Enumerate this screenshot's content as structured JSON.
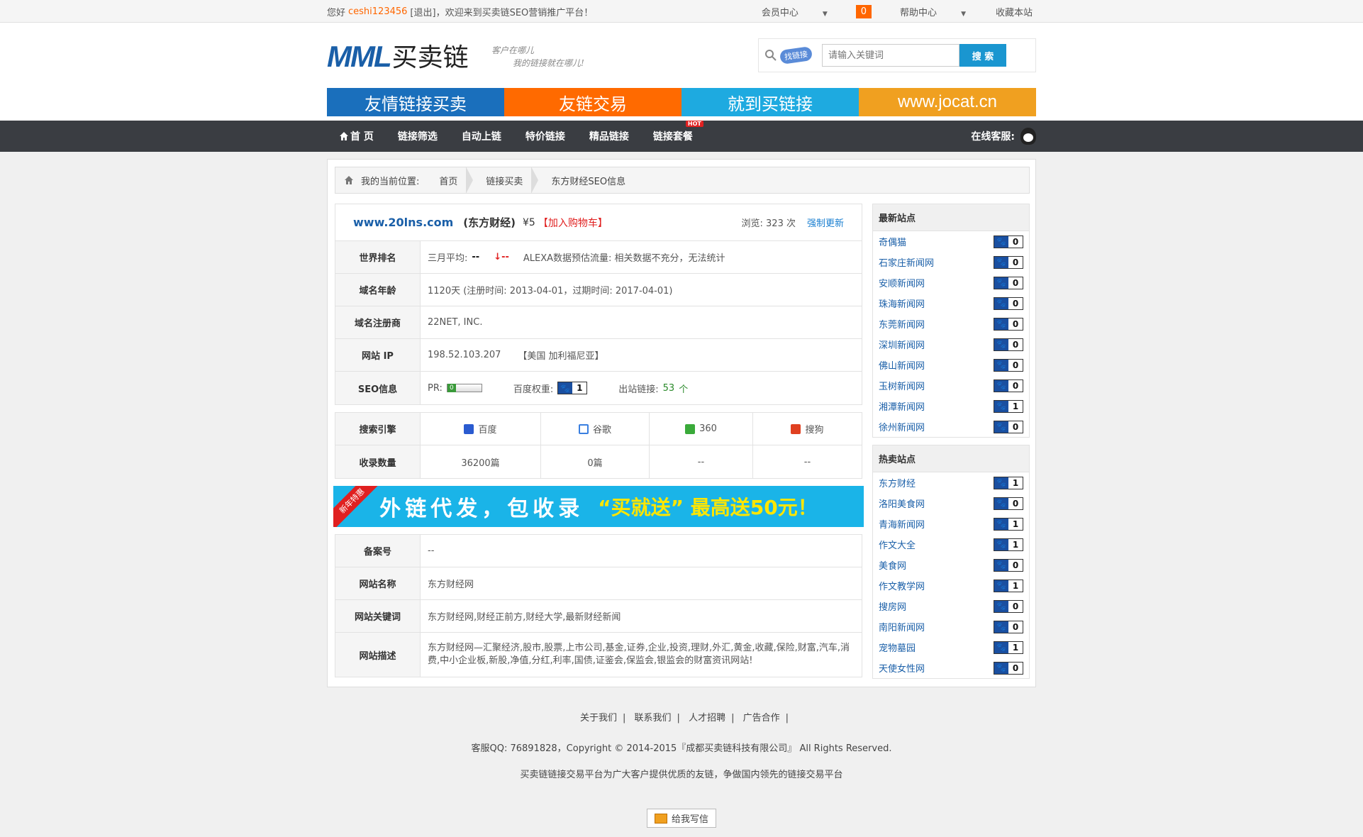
{
  "topbar": {
    "greeting": "您好",
    "username": "ceshi123456",
    "logout": "[退出]",
    "welcome": "，欢迎来到买卖链SEO营销推广平台！",
    "member": "会员中心",
    "cart_count": "0",
    "help": "帮助中心",
    "favorite": "收藏本站"
  },
  "header": {
    "logo_latin": "MML",
    "logo_cn": "买卖链",
    "slogan1": "客户在哪儿",
    "slogan2": "我的链接就在哪儿!",
    "search_badge": "找链接",
    "search_placeholder": "请输入关键词",
    "search_button": "搜 索",
    "banner": [
      "友情链接买卖",
      "友链交易",
      "就到买链接",
      "www.jocat.cn"
    ]
  },
  "nav": {
    "items": [
      "首 页",
      "链接筛选",
      "自动上链",
      "特价链接",
      "精品链接",
      "链接套餐"
    ],
    "hot": "HOT",
    "service": "在线客服:"
  },
  "breadcrumb": {
    "label": "我的当前位置:",
    "items": [
      "首页",
      "链接买卖",
      "东方财经SEO信息"
    ]
  },
  "site": {
    "url": "www.20lns.com",
    "name": "(东方财经)",
    "price": "¥5",
    "add_cart": "【加入购物车】",
    "views": "浏览: 323 次",
    "refresh": "强制更新"
  },
  "info": {
    "rank_label": "世界排名",
    "rank_avg": "三月平均:",
    "rank_val": "--",
    "rank_trend": "↓--",
    "rank_note": "ALEXA数据预估流量: 相关数据不充分，无法统计",
    "age_label": "域名年龄",
    "age_val": "1120天 (注册时间: 2013-04-01，过期时间: 2017-04-01)",
    "registrar_label": "域名注册商",
    "registrar_val": "22NET, INC.",
    "ip_label": "网站 IP",
    "ip_val": "198.52.103.207",
    "ip_loc": "【美国 加利福尼亚】",
    "seo_label": "SEO信息",
    "pr_label": "PR:",
    "weight_label": "百度权重:",
    "weight_val": "1",
    "outlinks_label": "出站链接:",
    "outlinks_val": "53",
    "outlinks_unit": "个"
  },
  "engines": {
    "label": "搜索引擎",
    "index_label": "收录数量",
    "names": [
      "百度",
      "谷歌",
      "360",
      "搜狗"
    ],
    "counts": [
      "36200篇",
      "0篇",
      "--",
      "--"
    ]
  },
  "promo": {
    "tag": "新年特惠",
    "text1": "外链代发，包收录",
    "text2": "“买就送” 最高送50元！"
  },
  "meta": {
    "icp_label": "备案号",
    "icp_val": "--",
    "sitename_label": "网站名称",
    "sitename_val": "东方财经网",
    "keywords_label": "网站关键词",
    "keywords_val": "东方财经网,财经正前方,财经大学,最新财经新闻",
    "desc_label": "网站描述",
    "desc_val": "东方财经网—汇聚经济,股市,股票,上市公司,基金,证券,企业,投资,理财,外汇,黄金,收藏,保险,财富,汽车,消费,中小企业板,新股,净值,分红,利率,国债,证鉴会,保监会,银监会的财富资讯网站!"
  },
  "latest": {
    "title": "最新站点",
    "items": [
      {
        "name": "奇偶猫",
        "w": "0"
      },
      {
        "name": "石家庄新闻网",
        "w": "0"
      },
      {
        "name": "安顺新闻网",
        "w": "0"
      },
      {
        "name": "珠海新闻网",
        "w": "0"
      },
      {
        "name": "东莞新闻网",
        "w": "0"
      },
      {
        "name": "深圳新闻网",
        "w": "0"
      },
      {
        "name": "佛山新闻网",
        "w": "0"
      },
      {
        "name": "玉树新闻网",
        "w": "0"
      },
      {
        "name": "湘潭新闻网",
        "w": "1"
      },
      {
        "name": "徐州新闻网",
        "w": "0"
      }
    ]
  },
  "hot": {
    "title": "热卖站点",
    "items": [
      {
        "name": "东方财经",
        "w": "1"
      },
      {
        "name": "洛阳美食网",
        "w": "0"
      },
      {
        "name": "青海新闻网",
        "w": "1"
      },
      {
        "name": "作文大全",
        "w": "1"
      },
      {
        "name": "美食网",
        "w": "0"
      },
      {
        "name": "作文教学网",
        "w": "1"
      },
      {
        "name": "搜房网",
        "w": "0"
      },
      {
        "name": "南阳新闻网",
        "w": "0"
      },
      {
        "name": "宠物墓园",
        "w": "1"
      },
      {
        "name": "天使女性网",
        "w": "0"
      }
    ]
  },
  "footer": {
    "links": [
      "关于我们",
      "联系我们",
      "人才招聘",
      "广告合作"
    ],
    "copyright": "客服QQ: 76891828，Copyright © 2014-2015『成都买卖链科技有限公司』 All Rights Reserved.",
    "tagline": "买卖链链接交易平台为广大客户提供优质的友链，争做国内领先的链接交易平台",
    "mail": "给我写信"
  },
  "colors": {
    "accent": "#ff6600",
    "nav_bg": "#3a3d42",
    "link": "#1a5fa8"
  }
}
